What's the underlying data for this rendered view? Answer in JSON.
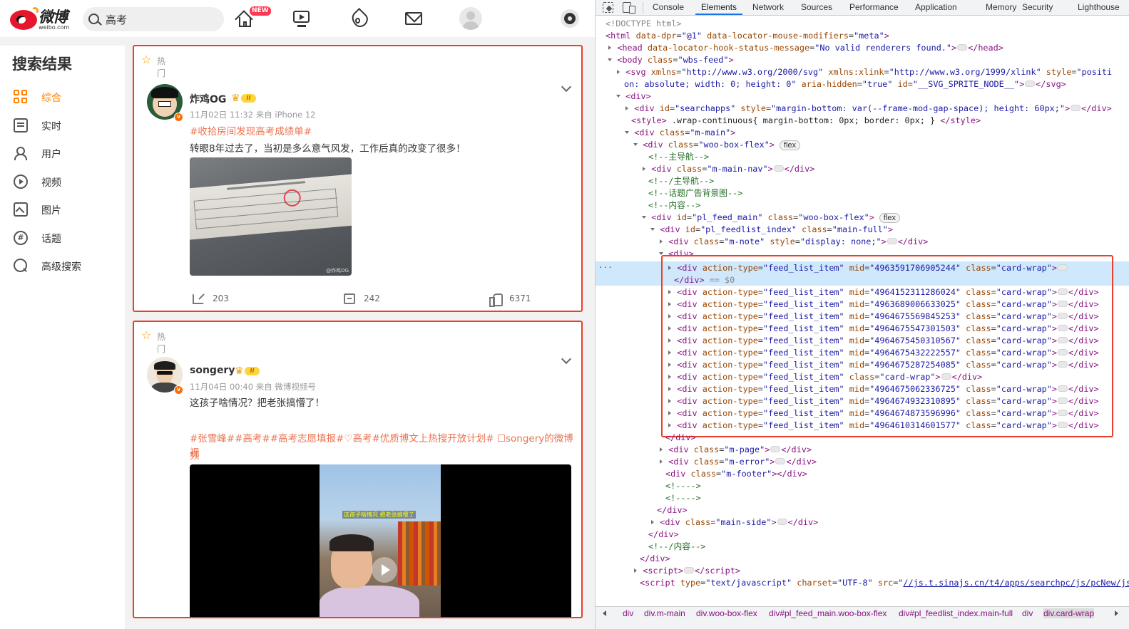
{
  "weibo": {
    "logo": {
      "cn": "微博",
      "en": "weibo.com"
    },
    "search": {
      "value": "高考"
    },
    "nav": {
      "home_badge": "NEW"
    },
    "sidebar": {
      "title": "搜索结果",
      "items": [
        {
          "label": "综合",
          "icon": "grid-icon",
          "active": true
        },
        {
          "label": "实时",
          "icon": "realtime-icon"
        },
        {
          "label": "用户",
          "icon": "user-icon"
        },
        {
          "label": "视频",
          "icon": "play-circle-icon"
        },
        {
          "label": "图片",
          "icon": "image-icon"
        },
        {
          "label": "话题",
          "icon": "hashtag-icon"
        },
        {
          "label": "高级搜索",
          "icon": "search-icon"
        }
      ]
    },
    "feed": [
      {
        "hot_label": "热门",
        "user": "炸鸡OG",
        "level": "II",
        "meta": "11月02日 11:32  来自 iPhone 12",
        "topic": "#收拾房间发现高考成绩单#",
        "text": "转眼8年过去了，当初是多么意气风发，工作后真的改变了很多！",
        "image_watermark": "@炸鸡OG",
        "reposts": "203",
        "comments": "242",
        "likes": "6371"
      },
      {
        "hot_label": "热门",
        "user": "songery",
        "level": "II",
        "meta": "11月04日 00:40  来自 微博视频号",
        "text": "这孩子啥情况？把老张搞懵了！",
        "topics_line1": "#张雪峰##高考##高考志愿填报#♡高考#优质博文上热搜开放计划# ☐songery的微博视",
        "topics_line2": "频",
        "video_caption": "这孩子啥情况 把老张搞懵了"
      }
    ]
  },
  "devtools": {
    "tabs": [
      "Console",
      "Elements",
      "Network",
      "Sources",
      "Performance",
      "Application",
      "Memory",
      "Security",
      "Lighthouse"
    ],
    "active_tab": "Elements",
    "breadcrumbs": [
      "div",
      "div.m-main",
      "div.woo-box-flex",
      "div#pl_feed_main.woo-box-flex",
      "div#pl_feedlist_index.main-full",
      "div",
      "div.card-wrap"
    ],
    "feed_items": [
      {
        "mid": "4963591706905244"
      },
      {
        "mid": "4964152311286024"
      },
      {
        "mid": "4963689006633025"
      },
      {
        "mid": "4964675569845253"
      },
      {
        "mid": "4964675547301503"
      },
      {
        "mid": "4964675450310567"
      },
      {
        "mid": "4964675432222557"
      },
      {
        "mid": "4964675287254085"
      },
      {
        "mid": ""
      },
      {
        "mid": "4964675062336725"
      },
      {
        "mid": "4964674932310895"
      },
      {
        "mid": "4964674873596996"
      },
      {
        "mid": "4964610314601577"
      }
    ],
    "script_src": "//js.t.sinajs.cn/t4/apps/searchpc/js/pcNew/js/conf/base.js?version=202301301433"
  }
}
